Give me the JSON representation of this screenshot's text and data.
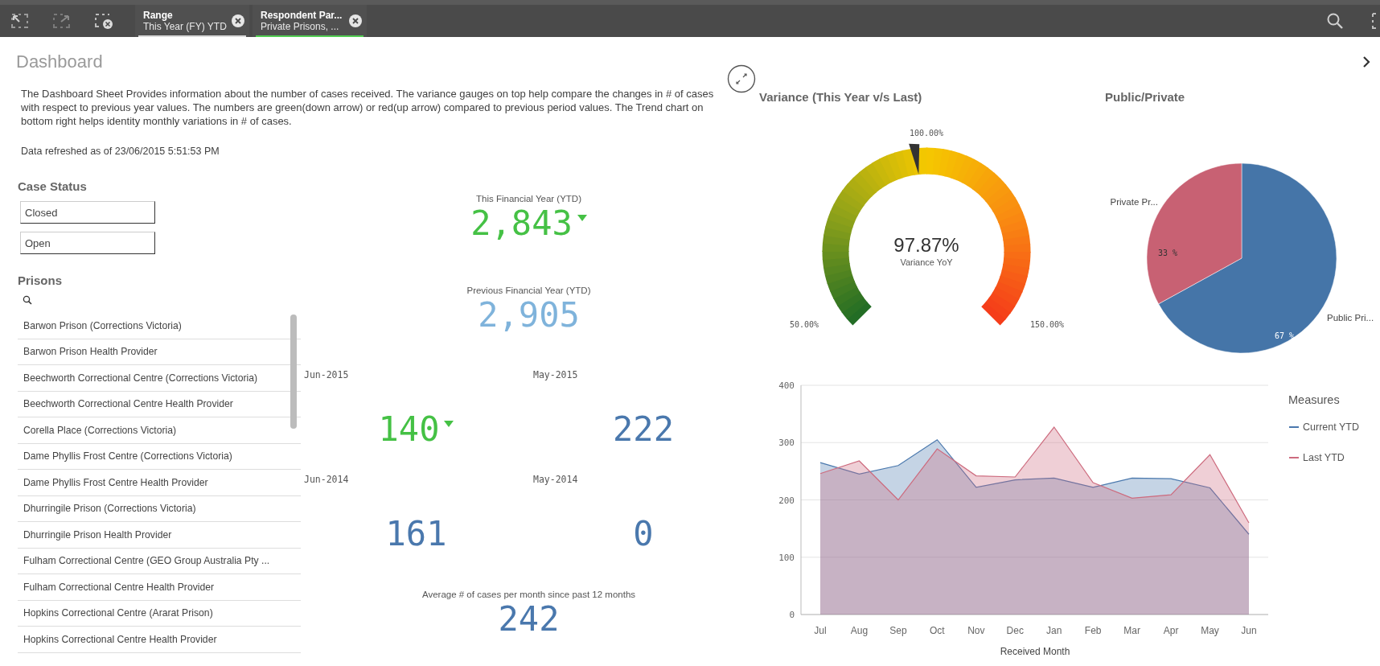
{
  "toolbar": {
    "selections": [
      {
        "field": "Range",
        "value": "This Year (FY) YTD",
        "color": "#d9d9d9"
      },
      {
        "field": "Respondent Par...",
        "value": "Private Prisons, ...",
        "color": "#52cc52"
      }
    ]
  },
  "sheet": {
    "title": "Dashboard",
    "description": "The Dashboard Sheet Provides information about the number of cases received. The variance gauges on top help compare the changes in # of cases with respect to previous year values. The numbers are green(down arrow) or red(up arrow) compared to previous period values. The Trend chart on bottom right helps identity monthly variations in # of cases.",
    "refreshed": "Data refreshed as of 23/06/2015 5:51:53 PM"
  },
  "case_status": {
    "title": "Case Status",
    "items": [
      {
        "label": "Closed"
      },
      {
        "label": "Open"
      }
    ]
  },
  "prisons": {
    "title": "Prisons",
    "items": [
      "Barwon Prison (Corrections Victoria)",
      "Barwon Prison Health Provider",
      "Beechworth Correctional Centre (Corrections Victoria)",
      "Beechworth Correctional Centre Health Provider",
      "Corella Place (Corrections Victoria)",
      "Dame Phyllis Frost Centre (Corrections Victoria)",
      "Dame Phyllis Frost Centre Health Provider",
      "Dhurringile Prison (Corrections Victoria)",
      "Dhurringile Prison Health Provider",
      "Fulham Correctional Centre (GEO Group Australia Pty ...",
      "Fulham Correctional Centre Health Provider",
      "Hopkins Correctional Centre (Ararat Prison)",
      "Hopkins Correctional Centre Health Provider"
    ]
  },
  "headline_kpis": [
    {
      "label": "This Financial Year (YTD)",
      "value": "2,843",
      "color": "#45c145",
      "down_arrow": true
    },
    {
      "label": "Previous Financial Year (YTD)",
      "value": "2,905",
      "color": "#7fb3db",
      "down_arrow": false
    }
  ],
  "monthly_kpis": [
    {
      "label": "Jun-2015",
      "value": "140",
      "color": "#45c145",
      "down_arrow": true
    },
    {
      "label": "May-2015",
      "value": "222",
      "color": "#4a78ad",
      "down_arrow": false
    },
    {
      "label": "Jun-2014",
      "value": "161",
      "color": "#4a78ad",
      "down_arrow": false
    },
    {
      "label": "May-2014",
      "value": "0",
      "color": "#4a78ad",
      "down_arrow": false
    }
  ],
  "average_kpi": {
    "label": "Average # of cases per month since past 12 months",
    "value": "242",
    "color": "#4a78ad"
  },
  "variance": {
    "title": "Variance (This Year v/s Last)",
    "level": 0.4787,
    "reading": "97.87%",
    "caption": "Variance YoY",
    "min_label": "50.00%",
    "mid_label": "100.00%",
    "max_label": "150.00%"
  },
  "public_private": {
    "title": "Public/Private",
    "chart_data": {
      "type": "pie",
      "categories": [
        "Public Pri...",
        "Private Pr..."
      ],
      "colors": [
        "#4575a8",
        "#c86173"
      ],
      "series": [
        {
          "values": [
            67,
            33
          ]
        }
      ],
      "value_labels": [
        "67 %",
        "33 %"
      ]
    }
  },
  "trend": {
    "chart_data": {
      "type": "area",
      "xlabel": "Received Month",
      "grid": true,
      "legend": {
        "title": "Measures"
      },
      "categories": [
        "Jul",
        "Aug",
        "Sep",
        "Oct",
        "Nov",
        "Dec",
        "Jan",
        "Feb",
        "Mar",
        "Apr",
        "May",
        "Jun"
      ],
      "series": [
        {
          "name": "Current YTD",
          "color": "#4a78ad",
          "values": [
            265,
            245,
            260,
            305,
            222,
            235,
            238,
            222,
            238,
            237,
            221,
            140
          ]
        },
        {
          "name": "Last YTD",
          "color": "#cd6b7e",
          "values": [
            246,
            268,
            200,
            289,
            242,
            240,
            327,
            230,
            203,
            209,
            279,
            160
          ]
        }
      ],
      "ylim": [
        0,
        400
      ],
      "yticks": [
        {
          "value": 0,
          "label": "0"
        },
        {
          "value": 100,
          "label": "100"
        },
        {
          "value": 200,
          "label": "200"
        },
        {
          "value": 300,
          "label": "300"
        },
        {
          "value": 400,
          "label": "400"
        }
      ]
    }
  }
}
